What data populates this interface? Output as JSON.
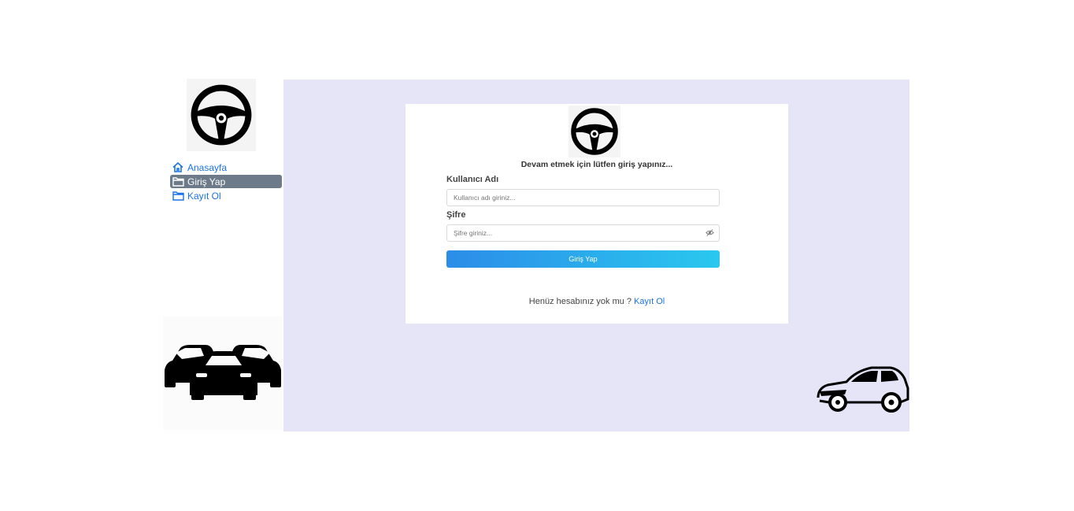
{
  "sidebar": {
    "logo_icon": "steering-wheel-icon",
    "items": [
      {
        "label": "Anasayfa",
        "icon": "home-icon",
        "active": false
      },
      {
        "label": "Giriş Yap",
        "icon": "folder-icon",
        "active": true
      },
      {
        "label": "Kayıt Ol",
        "icon": "folder-icon",
        "active": false
      }
    ],
    "image_icon": "cars-group-icon"
  },
  "login": {
    "logo_icon": "steering-wheel-icon",
    "subtitle": "Devam etmek için lütfen giriş yapınız...",
    "username_label": "Kullanıcı Adı",
    "username_placeholder": "Kullanıcı adı giriniz...",
    "password_label": "Şifre",
    "password_placeholder": "Şifre giriniz...",
    "password_toggle_icon": "eye-off-icon",
    "submit_label": "Giriş Yap",
    "register_prompt": "Henüz hesabınız yok mu ?",
    "register_link": "Kayıt Ol"
  },
  "decor": {
    "suv_icon": "suv-icon"
  },
  "colors": {
    "panel_bg": "#e5e5f7",
    "link": "#1a73e8",
    "active_nav": "#6c7a89",
    "button_gradient_start": "#2b8de8",
    "button_gradient_end": "#2ac8ef"
  }
}
